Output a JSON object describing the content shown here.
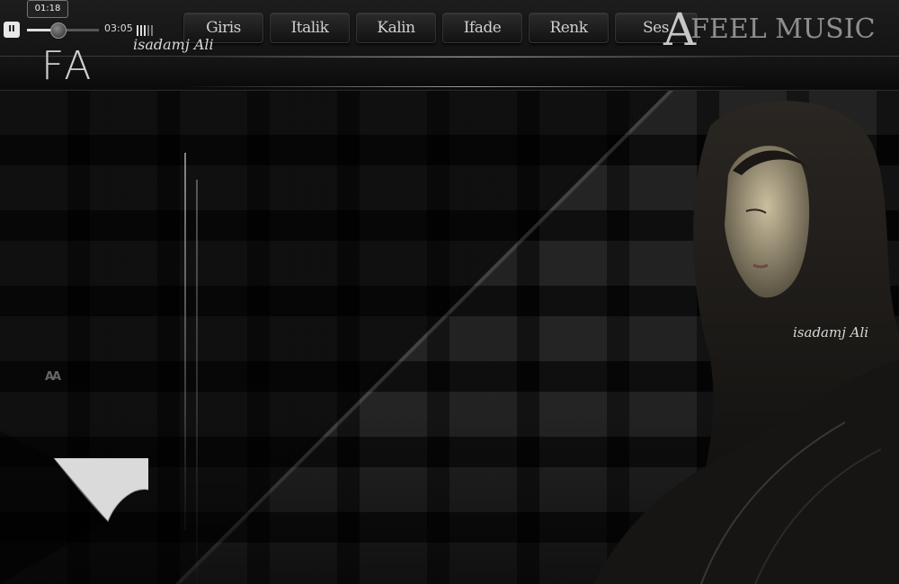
{
  "player": {
    "current_time": "01:18",
    "duration": "03:05",
    "progress": 0.42,
    "pause_symbol": "II"
  },
  "nav": {
    "items": [
      "Giris",
      "Italik",
      "Kalin",
      "Ifade",
      "Renk",
      "Ses"
    ]
  },
  "brand": {
    "initial": "A",
    "name": "FEEL MUSIC",
    "short_logo": "FA",
    "corner_logo": "AA"
  },
  "signatures": {
    "header": "isadamj Ali",
    "image": "isadamj Ali"
  },
  "icons": [
    "pause-icon",
    "volume-icon"
  ],
  "colors": {
    "background": "#121212",
    "text_light": "#cfcfcf",
    "accent_white": "#e8e8e8"
  }
}
